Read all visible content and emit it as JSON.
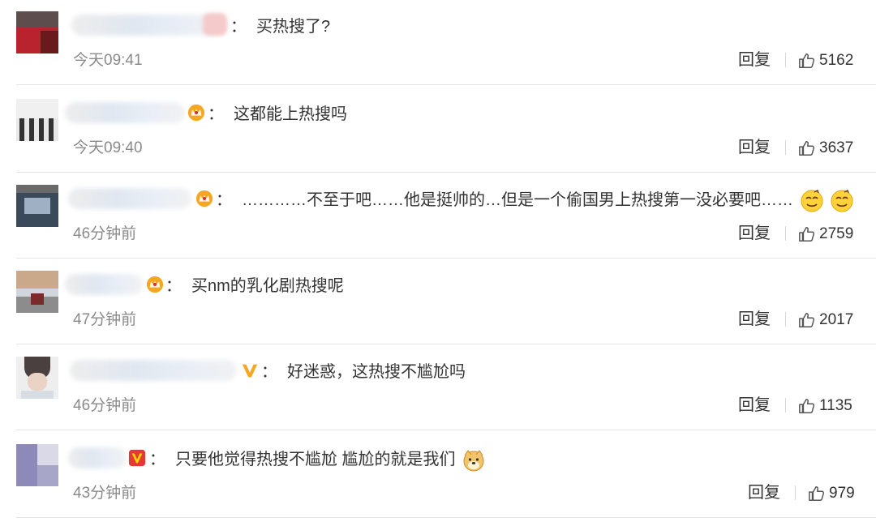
{
  "comments": [
    {
      "content": "买热搜了?",
      "time": "今天09:41",
      "reply_label": "回复",
      "likes": "5162",
      "badge": "none",
      "emojis": []
    },
    {
      "content": "这都能上热搜吗",
      "time": "今天09:40",
      "reply_label": "回复",
      "likes": "3637",
      "badge": "crown-icon",
      "emojis": []
    },
    {
      "content": "…………不至于吧……他是挺帅的…但是一个偷国男上热搜第一没必要吧……",
      "time": "46分钟前",
      "reply_label": "回复",
      "likes": "2759",
      "badge": "crown-icon",
      "emojis": [
        "smug-face-emoji",
        "smug-face-emoji"
      ]
    },
    {
      "content": "买nm的乳化剧热搜呢",
      "time": "47分钟前",
      "reply_label": "回复",
      "likes": "2017",
      "badge": "crown-icon",
      "emojis": []
    },
    {
      "content": "好迷惑，这热搜不尴尬吗",
      "time": "46分钟前",
      "reply_label": "回复",
      "likes": "1135",
      "badge": "verified-v-icon",
      "emojis": []
    },
    {
      "content": "只要他觉得热搜不尴尬 尴尬的就是我们",
      "time": "43分钟前",
      "reply_label": "回复",
      "likes": "979",
      "badge": "verified-v-icon",
      "emojis": [
        "doge-emoji"
      ]
    }
  ],
  "colon": "：",
  "colors": {
    "text": "#333333",
    "muted": "#8a8a8a",
    "divider": "#e3e3e3",
    "crown": "#f5a623",
    "verified": "#f5a623"
  }
}
